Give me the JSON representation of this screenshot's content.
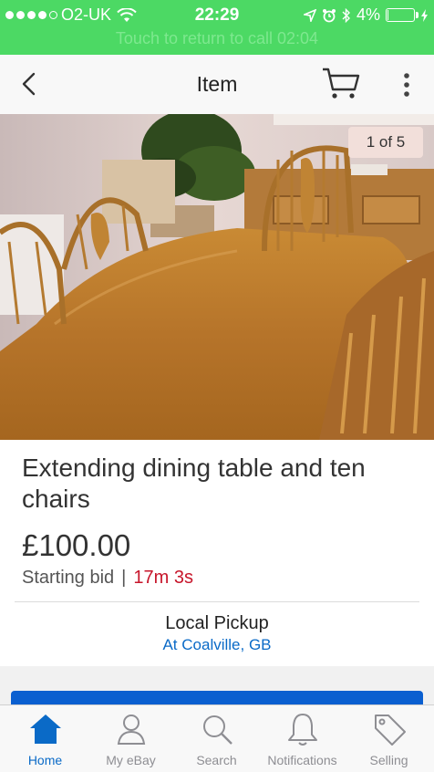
{
  "status_bar": {
    "carrier": "O2-UK",
    "time": "22:29",
    "battery_percent": "4%",
    "battery_level": 0.04,
    "call_banner": "Touch to return to call  02:04"
  },
  "nav": {
    "title": "Item"
  },
  "photo": {
    "counter": "1 of 5"
  },
  "item": {
    "title": "Extending dining table and ten chairs",
    "price": "£100.00",
    "bid_label": "Starting bid",
    "separator": "|",
    "time_left": "17m 3s",
    "pickup_label": "Local Pickup",
    "pickup_location": "At Coalville, GB"
  },
  "colors": {
    "status_green": "#4cd964",
    "accent_blue": "#0a6ac7",
    "time_red": "#c7162b"
  },
  "tabs": [
    {
      "label": "Home",
      "icon": "home-icon",
      "active": true
    },
    {
      "label": "My eBay",
      "icon": "person-icon",
      "active": false
    },
    {
      "label": "Search",
      "icon": "magnifier-icon",
      "active": false
    },
    {
      "label": "Notifications",
      "icon": "bell-icon",
      "active": false
    },
    {
      "label": "Selling",
      "icon": "tag-icon",
      "active": false
    }
  ]
}
